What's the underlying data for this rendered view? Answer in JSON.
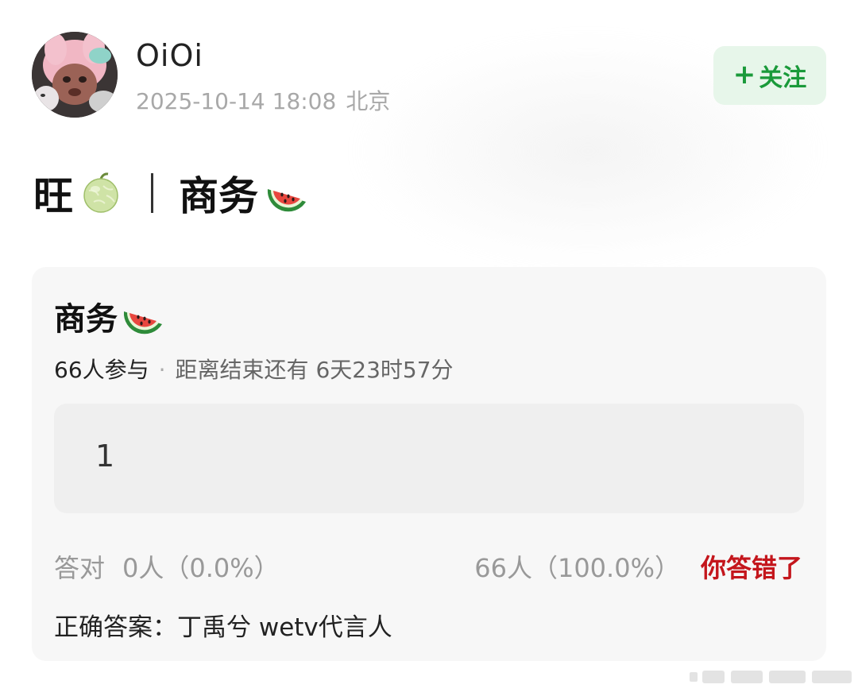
{
  "header": {
    "username": "OiOi",
    "datetime": "2025-10-14 18:08",
    "location": "北京",
    "follow_label": "关注",
    "follow_plus": "+"
  },
  "post": {
    "title_part1": "旺",
    "title_emoji1": "melon-emoji",
    "title_part2": "商务",
    "title_emoji2": "watermelon-emoji"
  },
  "poll": {
    "title": "商务",
    "title_emoji": "watermelon-emoji",
    "participants": "66人参与",
    "separator": "·",
    "remaining": "距离结束还有 6天23时57分",
    "option_text": "1",
    "correct_label": "答对",
    "correct_count": "0人（0.0%）",
    "wrong_count": "66人（100.0%）",
    "wrong_label": "你答错了",
    "answer": "正确答案：丁禹兮 wetv代言人"
  },
  "colors": {
    "follow_bg": "#e7f6ea",
    "follow_text": "#1a9a3a",
    "wrong_red": "#c4161c",
    "card_bg": "#f7f7f7",
    "option_bg": "#efefef"
  }
}
